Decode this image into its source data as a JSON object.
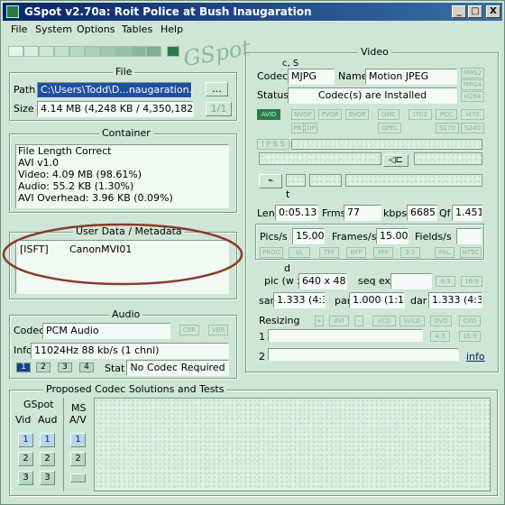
{
  "title": "GSpot v2.70a: Roit Police at Bush Inaugaration",
  "window_controls": {
    "minimize": "_",
    "maximize": "□",
    "close": "X"
  },
  "menu": [
    "File",
    "System",
    "Options",
    "Tables",
    "Help"
  ],
  "logo": "GSpot",
  "file": {
    "title": "File",
    "path_label": "Path",
    "path_value": "C:\\Users\\Todd\\D...naugaration.AVI",
    "browse": "...",
    "size_label": "Size",
    "size_value": "4.14 MB (4,248 KB / 4,350,182 byte",
    "page": "1/1"
  },
  "container": {
    "title": "Container",
    "lines": [
      "File Length Correct",
      "AVI v1.0",
      "Video: 4.09 MB (98.61%)",
      "Audio: 55.2 KB (1.30%)",
      "AVI Overhead: 3.96 KB (0.09%)"
    ]
  },
  "userdata": {
    "title": "User Data / Metadata",
    "key": "[ISFT]",
    "value": "CanonMVI01"
  },
  "audio": {
    "title": "Audio",
    "codec_label": "Codec",
    "codec_value": "PCM Audio",
    "cbr": "CBR",
    "vbr": "VBR",
    "info_label": "Info",
    "info_value": "11024Hz  88 kb/s (1 chnl)",
    "streams": [
      "1",
      "2",
      "3",
      "4"
    ],
    "stat_label": "Stat",
    "stat_value": "No Codec Required"
  },
  "proposed": {
    "title": "Proposed Codec Solutions and Tests",
    "gspot": "GSpot",
    "vid": "Vid",
    "aud": "Aud",
    "ms": "MS",
    "av": "A/V",
    "nums": [
      "1",
      "2",
      "3"
    ]
  },
  "video": {
    "title": "Video",
    "cs": "c, S",
    "codec_label": "Codec",
    "codec_value": "MJPG",
    "name_label": "Name",
    "name_value": "Motion JPEG",
    "status_label": "Status",
    "status_value": "Codec(s) are Installed",
    "side_pills": [
      "MPG2",
      "MPG4",
      "H264"
    ],
    "row1": [
      "AVID",
      "NVOP",
      "PVOP",
      "BVOP",
      "GMC",
      "I703",
      "PCC",
      "I470"
    ],
    "row2": [
      "PB",
      "DP",
      "QPEL",
      "S170",
      "S240"
    ],
    "ipbs": "I P B S",
    "t_label": "t",
    "len_label": "Len",
    "len_value": "0:05.133",
    "frms_label": "Frms",
    "frms_value": "77",
    "kbps_label": "kbps",
    "kbps_value": "6685",
    "qf_label": "Qf",
    "qf_value": "1.451",
    "pics_label": "Pics/s",
    "pics_value": "15.000",
    "frames_label": "Frames/s",
    "frames_value": "15.000",
    "fields_label": "Fields/s",
    "flags": [
      "PROG",
      "I/L",
      "TFF",
      "BFF",
      "FFF",
      "3:2",
      "PAL",
      "NTSC"
    ],
    "d_label": "d",
    "pic_label": "pic (w x h)",
    "pic_value": "640 x 480",
    "seqext_label": "seq ext",
    "ar1": "4:3",
    "ar2": "16:9",
    "sar_label": "sar",
    "sar_value": "1.333 (4:3)",
    "par_label": "par",
    "par_value": "1.000 (1:1)",
    "dar_label": "dar",
    "dar_value": "1.333 (4:3)",
    "resizing_label": "Resizing",
    "resize_btns": [
      "+",
      "AVI",
      "-",
      "VCD",
      "SVCD",
      "DVD",
      "CVD"
    ],
    "row1_label": "1",
    "row2_label": "2",
    "r1_ar": [
      "4:3",
      "16:9"
    ],
    "info_link": "info"
  },
  "colors": {
    "titlebar": "#0a246a",
    "background": "#cfe6d6",
    "ellipse": "#8b3a2a"
  }
}
